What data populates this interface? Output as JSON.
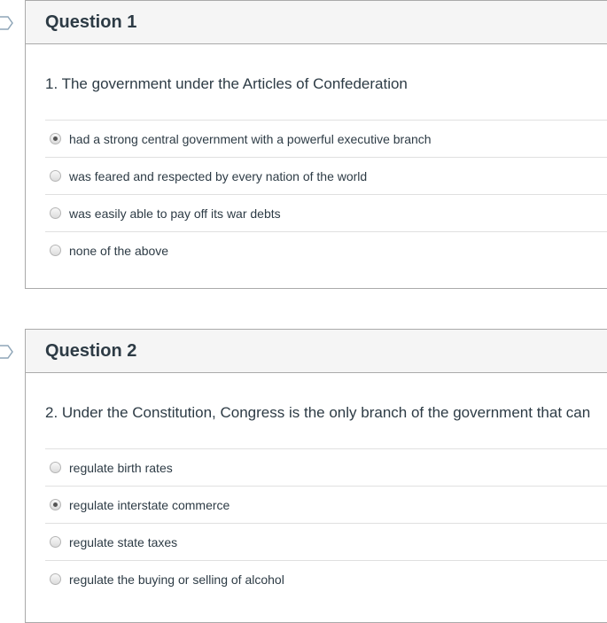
{
  "questions": [
    {
      "title": "Question 1",
      "text": "1. The government under the Articles of Confederation",
      "answers": [
        {
          "label": "had a strong central government with a powerful executive branch",
          "selected": true
        },
        {
          "label": "was feared and respected by every nation of the world",
          "selected": false
        },
        {
          "label": "was easily able to pay off its war debts",
          "selected": false
        },
        {
          "label": "none of the above",
          "selected": false
        }
      ]
    },
    {
      "title": "Question 2",
      "text": "2. Under the Constitution, Congress is the only branch of the government that can",
      "answers": [
        {
          "label": "regulate birth rates",
          "selected": false
        },
        {
          "label": "regulate interstate commerce",
          "selected": true
        },
        {
          "label": "regulate state taxes",
          "selected": false
        },
        {
          "label": "regulate the buying or selling of alcohol",
          "selected": false
        }
      ]
    }
  ]
}
